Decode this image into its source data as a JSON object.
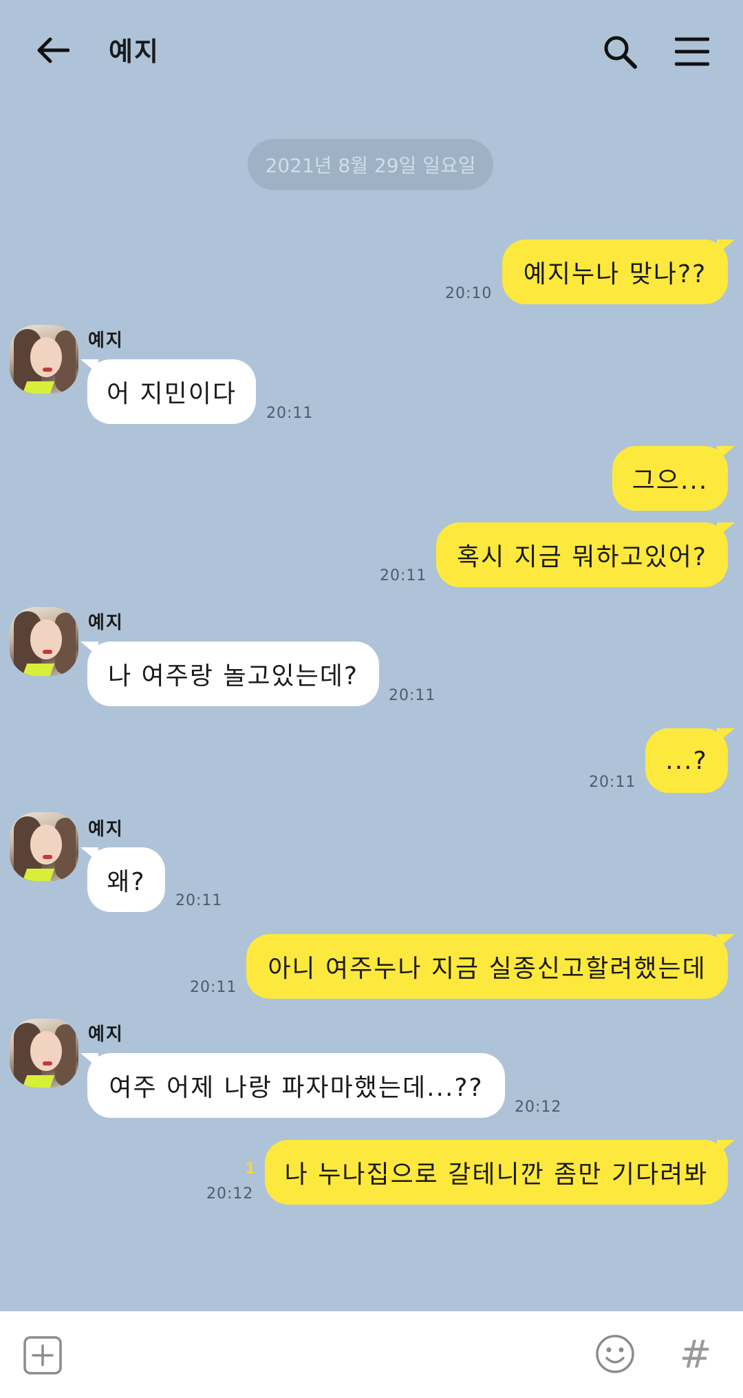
{
  "header": {
    "title": "예지",
    "back_icon": "arrow-left-icon",
    "search_icon": "search-icon",
    "menu_icon": "menu-icon"
  },
  "date_divider": "2021년 8월 29일 일요일",
  "messages": [
    {
      "from": "me",
      "text": "예지누나 맞나??",
      "time": "20:10"
    },
    {
      "from": "them",
      "sender": "예지",
      "text": "어 지민이다",
      "time": "20:11"
    },
    {
      "from": "me",
      "text": "그으...",
      "time": ""
    },
    {
      "from": "me",
      "text": "혹시 지금 뭐하고있어?",
      "time": "20:11"
    },
    {
      "from": "them",
      "sender": "예지",
      "text": "나 여주랑 놀고있는데?",
      "time": "20:11"
    },
    {
      "from": "me",
      "text": "...?",
      "time": "20:11"
    },
    {
      "from": "them",
      "sender": "예지",
      "text": "왜?",
      "time": "20:11"
    },
    {
      "from": "me",
      "text": "아니 여주누나 지금 실종신고할려했는데",
      "time": "20:11"
    },
    {
      "from": "them",
      "sender": "예지",
      "text": "여주 어제 나랑 파자마했는데...??",
      "time": "20:12"
    },
    {
      "from": "me",
      "text": "나 누나집으로 갈테니깐 좀만 기다려봐",
      "time": "20:12",
      "unread": "1"
    }
  ],
  "footer": {
    "plus_icon": "plus-square-icon",
    "emoji_icon": "emoji-icon",
    "hash_label": "#"
  },
  "colors": {
    "background": "#aec3d8",
    "my_bubble": "#fde83d",
    "their_bubble": "#ffffff",
    "unread": "#f3d836"
  }
}
